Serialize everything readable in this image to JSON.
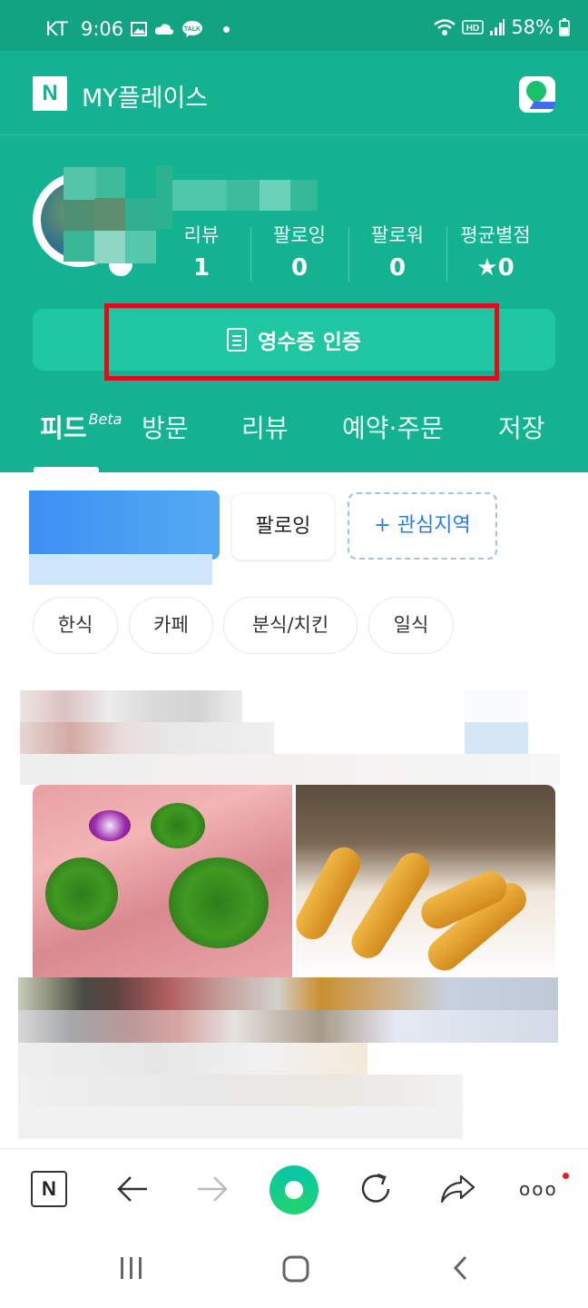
{
  "status_bar": {
    "carrier": "KT",
    "time": "9:06",
    "battery": "58%",
    "left_icons": [
      "gallery-icon",
      "cloud-icon",
      "kakaotalk-icon",
      "dot-icon"
    ],
    "right_icons": [
      "wifi-icon",
      "hd-icon",
      "signal-icon",
      "battery-icon"
    ],
    "kakaotalk_label": "TALK",
    "hd_label": "HD"
  },
  "header": {
    "logo": "N",
    "title": "MY플레이스"
  },
  "profile": {
    "stats": [
      {
        "label": "리뷰",
        "value": "1"
      },
      {
        "label": "팔로잉",
        "value": "0"
      },
      {
        "label": "팔로워",
        "value": "0"
      },
      {
        "label": "평균별점",
        "value": "★0"
      }
    ]
  },
  "receipt_button": {
    "label": "영수증 인증"
  },
  "tabs": [
    {
      "label": "피드",
      "badge": "Beta",
      "active": true
    },
    {
      "label": "방문"
    },
    {
      "label": "리뷰"
    },
    {
      "label": "예약·주문"
    },
    {
      "label": "저장"
    }
  ],
  "feed": {
    "follow_chip": "팔로잉",
    "region_chip": "+ 관심지역",
    "categories": [
      "한식",
      "카페",
      "분식/치킨",
      "일식"
    ]
  },
  "browser_bar": {
    "n_label": "N",
    "more_label": "ooo"
  },
  "colors": {
    "brand_green": "#13b391",
    "button_green": "#1ec7a1",
    "highlight_red": "#e30b14",
    "link_blue": "#2c7ce5"
  }
}
